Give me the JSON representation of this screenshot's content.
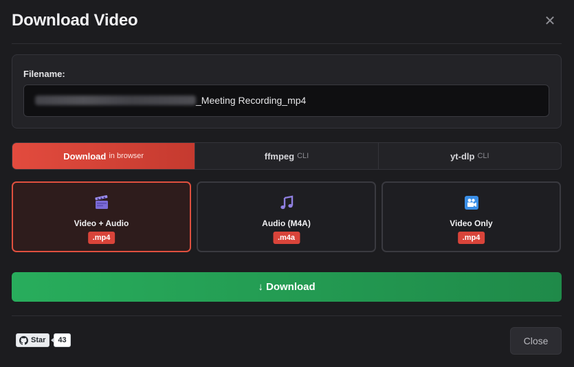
{
  "dialog": {
    "title": "Download Video",
    "close_icon": "close-icon"
  },
  "filename": {
    "label": "Filename:",
    "value_suffix": "_Meeting Recording_mp4"
  },
  "tabs": [
    {
      "label": "Download",
      "sub": "in browser",
      "active": true
    },
    {
      "label": "ffmpeg",
      "sub": "CLI",
      "active": false
    },
    {
      "label": "yt-dlp",
      "sub": "CLI",
      "active": false
    }
  ],
  "formats": [
    {
      "label": "Video + Audio",
      "badge": ".mp4",
      "icon": "clapper-board-icon",
      "selected": true
    },
    {
      "label": "Audio (M4A)",
      "badge": ".m4a",
      "icon": "music-note-icon",
      "selected": false
    },
    {
      "label": "Video Only",
      "badge": ".mp4",
      "icon": "video-camera-icon",
      "selected": false
    }
  ],
  "download_button": {
    "label": "↓ Download"
  },
  "github": {
    "star_label": "Star",
    "count": "43",
    "icon": "github-icon"
  },
  "close_button": {
    "label": "Close"
  },
  "colors": {
    "background": "#1c1c1f",
    "accent_red": "#e24b3e",
    "download_green": "#28ad5c",
    "badge_red": "#d9443a"
  }
}
